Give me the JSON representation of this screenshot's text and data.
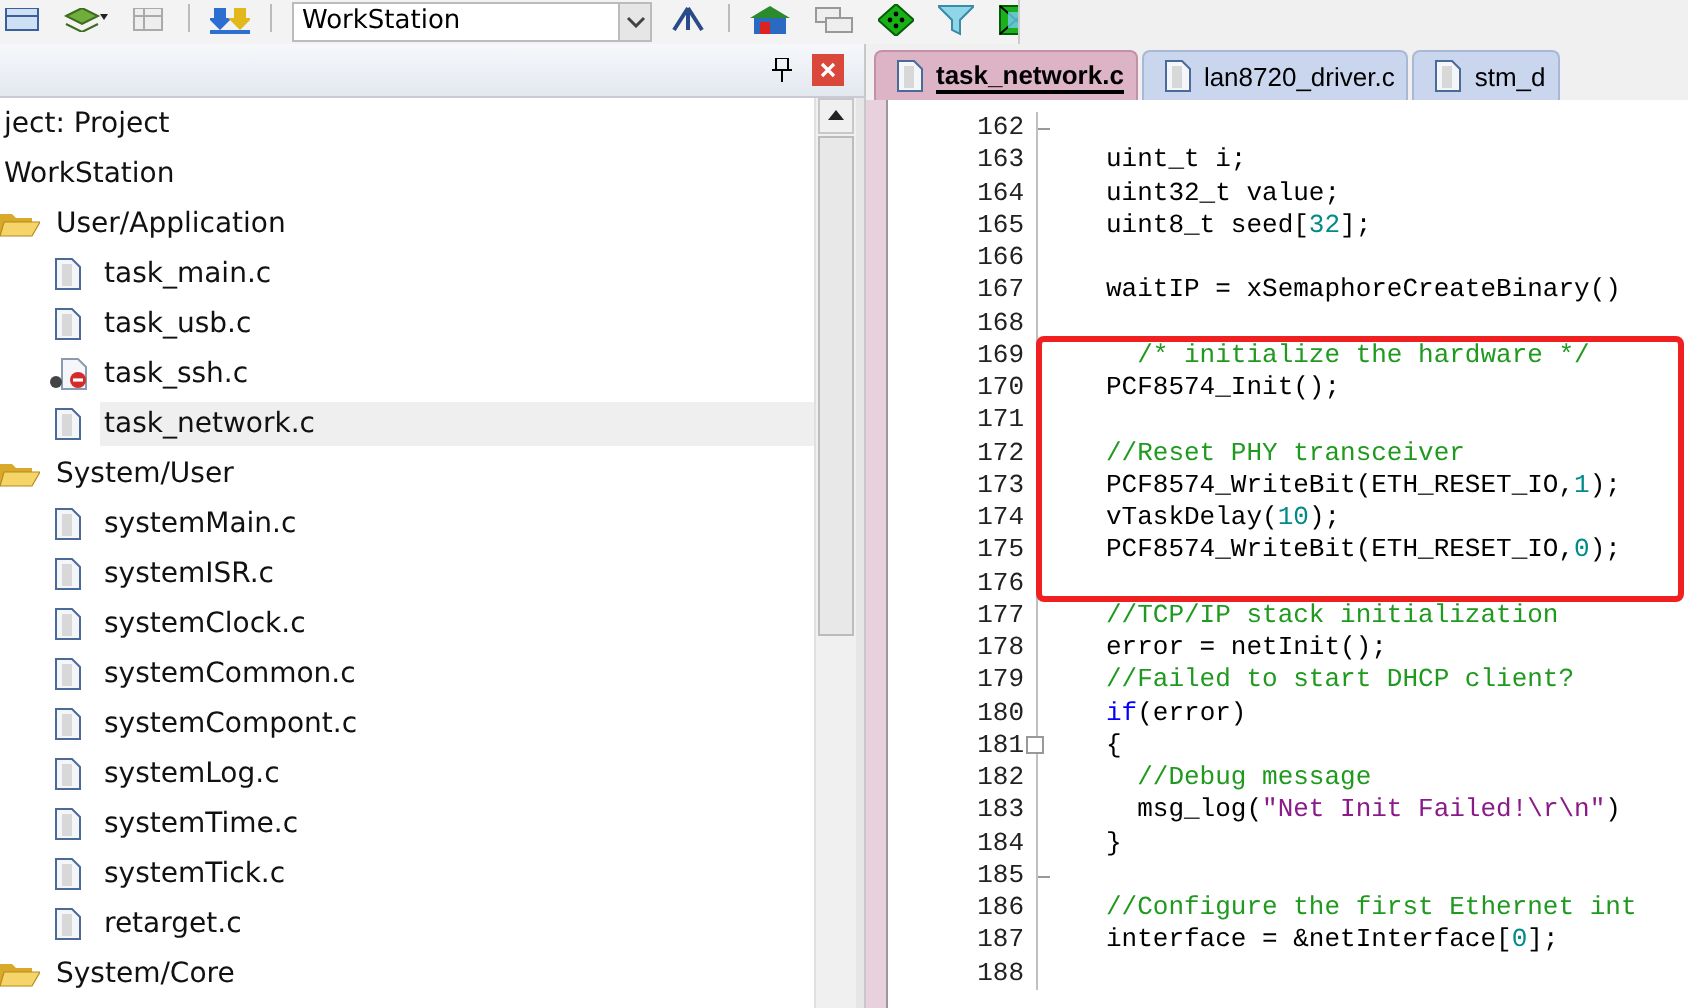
{
  "toolbar": {
    "target_select": {
      "value": "WorkStation"
    }
  },
  "project_panel": {
    "tree": [
      {
        "label": "ject: Project",
        "selected": false,
        "children": [
          {
            "label": "WorkStation",
            "selected": false,
            "children": [
              {
                "label": "User/Application",
                "kind": "group",
                "selected": false,
                "children": [
                  {
                    "label": "task_main.c",
                    "kind": "file",
                    "selected": false,
                    "excluded": false
                  },
                  {
                    "label": "task_usb.c",
                    "kind": "file",
                    "selected": false,
                    "excluded": false
                  },
                  {
                    "label": "task_ssh.c",
                    "kind": "file",
                    "selected": false,
                    "excluded": true
                  },
                  {
                    "label": "task_network.c",
                    "kind": "file",
                    "selected": true,
                    "excluded": false
                  }
                ]
              },
              {
                "label": "System/User",
                "kind": "group",
                "selected": false,
                "children": [
                  {
                    "label": "systemMain.c",
                    "kind": "file",
                    "selected": false,
                    "excluded": false
                  },
                  {
                    "label": "systemISR.c",
                    "kind": "file",
                    "selected": false,
                    "excluded": false
                  },
                  {
                    "label": "systemClock.c",
                    "kind": "file",
                    "selected": false,
                    "excluded": false
                  },
                  {
                    "label": "systemCommon.c",
                    "kind": "file",
                    "selected": false,
                    "excluded": false
                  },
                  {
                    "label": "systemCompont.c",
                    "kind": "file",
                    "selected": false,
                    "excluded": false
                  },
                  {
                    "label": "systemLog.c",
                    "kind": "file",
                    "selected": false,
                    "excluded": false
                  },
                  {
                    "label": "systemTime.c",
                    "kind": "file",
                    "selected": false,
                    "excluded": false
                  },
                  {
                    "label": "systemTick.c",
                    "kind": "file",
                    "selected": false,
                    "excluded": false
                  },
                  {
                    "label": "retarget.c",
                    "kind": "file",
                    "selected": false,
                    "excluded": false
                  }
                ]
              },
              {
                "label": "System/Core",
                "kind": "group",
                "selected": false
              }
            ]
          }
        ]
      }
    ]
  },
  "tabs": [
    {
      "label": "task_network.c",
      "selected": true
    },
    {
      "label": "lan8720_driver.c",
      "selected": false
    },
    {
      "label": "stm_d",
      "selected": false
    }
  ],
  "editor": {
    "lines": [
      {
        "number": "162",
        "fold_end": true
      },
      {
        "number": "163",
        "segments": [
          {
            "kind": "plain",
            "text": "uint_t i;"
          }
        ]
      },
      {
        "number": "164",
        "segments": [
          {
            "kind": "plain",
            "text": "uint32_t value;"
          }
        ]
      },
      {
        "number": "165",
        "segments": [
          {
            "kind": "plain",
            "text": "uint8_t seed["
          },
          {
            "kind": "number",
            "text": "32"
          },
          {
            "kind": "plain",
            "text": "];"
          }
        ]
      },
      {
        "number": "166"
      },
      {
        "number": "167",
        "segments": [
          {
            "kind": "plain",
            "text": "waitIP = xSemaphoreCreateBinary()"
          }
        ]
      },
      {
        "number": "168"
      },
      {
        "number": "169",
        "highlighted": true,
        "segments": [
          {
            "kind": "comment",
            "text": "  /* initialize the hardware */"
          }
        ]
      },
      {
        "number": "170",
        "highlighted": true,
        "segments": [
          {
            "kind": "plain",
            "text": "PCF8574_Init();"
          }
        ]
      },
      {
        "number": "171",
        "highlighted": true
      },
      {
        "number": "172",
        "highlighted": true,
        "segments": [
          {
            "kind": "comment",
            "text": "//Reset PHY transceiver"
          }
        ]
      },
      {
        "number": "173",
        "highlighted": true,
        "segments": [
          {
            "kind": "plain",
            "text": "PCF8574_WriteBit(ETH_RESET_IO,"
          },
          {
            "kind": "number",
            "text": "1"
          },
          {
            "kind": "plain",
            "text": ");"
          }
        ]
      },
      {
        "number": "174",
        "highlighted": true,
        "segments": [
          {
            "kind": "plain",
            "text": "vTaskDelay("
          },
          {
            "kind": "number",
            "text": "10"
          },
          {
            "kind": "plain",
            "text": ");"
          }
        ]
      },
      {
        "number": "175",
        "highlighted": true,
        "segments": [
          {
            "kind": "plain",
            "text": "PCF8574_WriteBit(ETH_RESET_IO,"
          },
          {
            "kind": "number",
            "text": "0"
          },
          {
            "kind": "plain",
            "text": ");"
          }
        ]
      },
      {
        "number": "176",
        "highlighted": true
      },
      {
        "number": "177",
        "segments": [
          {
            "kind": "comment",
            "text": "//TCP/IP stack initialization"
          }
        ]
      },
      {
        "number": "178",
        "segments": [
          {
            "kind": "plain",
            "text": "error = netInit();"
          }
        ]
      },
      {
        "number": "179",
        "segments": [
          {
            "kind": "comment",
            "text": "//Failed to start DHCP client?"
          }
        ]
      },
      {
        "number": "180",
        "segments": [
          {
            "kind": "keyword",
            "text": "if"
          },
          {
            "kind": "plain",
            "text": "(error)"
          }
        ]
      },
      {
        "number": "181",
        "fold_start": true,
        "segments": [
          {
            "kind": "plain",
            "text": "{"
          }
        ]
      },
      {
        "number": "182",
        "segments": [
          {
            "kind": "comment",
            "text": "  //Debug message"
          }
        ]
      },
      {
        "number": "183",
        "segments": [
          {
            "kind": "plain",
            "text": "  msg_log("
          },
          {
            "kind": "string",
            "text": "\"Net Init Failed!\\r\\n\""
          },
          {
            "kind": "plain",
            "text": ")"
          }
        ]
      },
      {
        "number": "184",
        "segments": [
          {
            "kind": "plain",
            "text": "}"
          }
        ]
      },
      {
        "number": "185",
        "fold_end": true
      },
      {
        "number": "186",
        "segments": [
          {
            "kind": "comment",
            "text": "//Configure the first Ethernet int"
          }
        ]
      },
      {
        "number": "187",
        "segments": [
          {
            "kind": "plain",
            "text": "interface = &netInterface["
          },
          {
            "kind": "number",
            "text": "0"
          },
          {
            "kind": "plain",
            "text": "];"
          }
        ]
      },
      {
        "number": "188"
      }
    ]
  }
}
